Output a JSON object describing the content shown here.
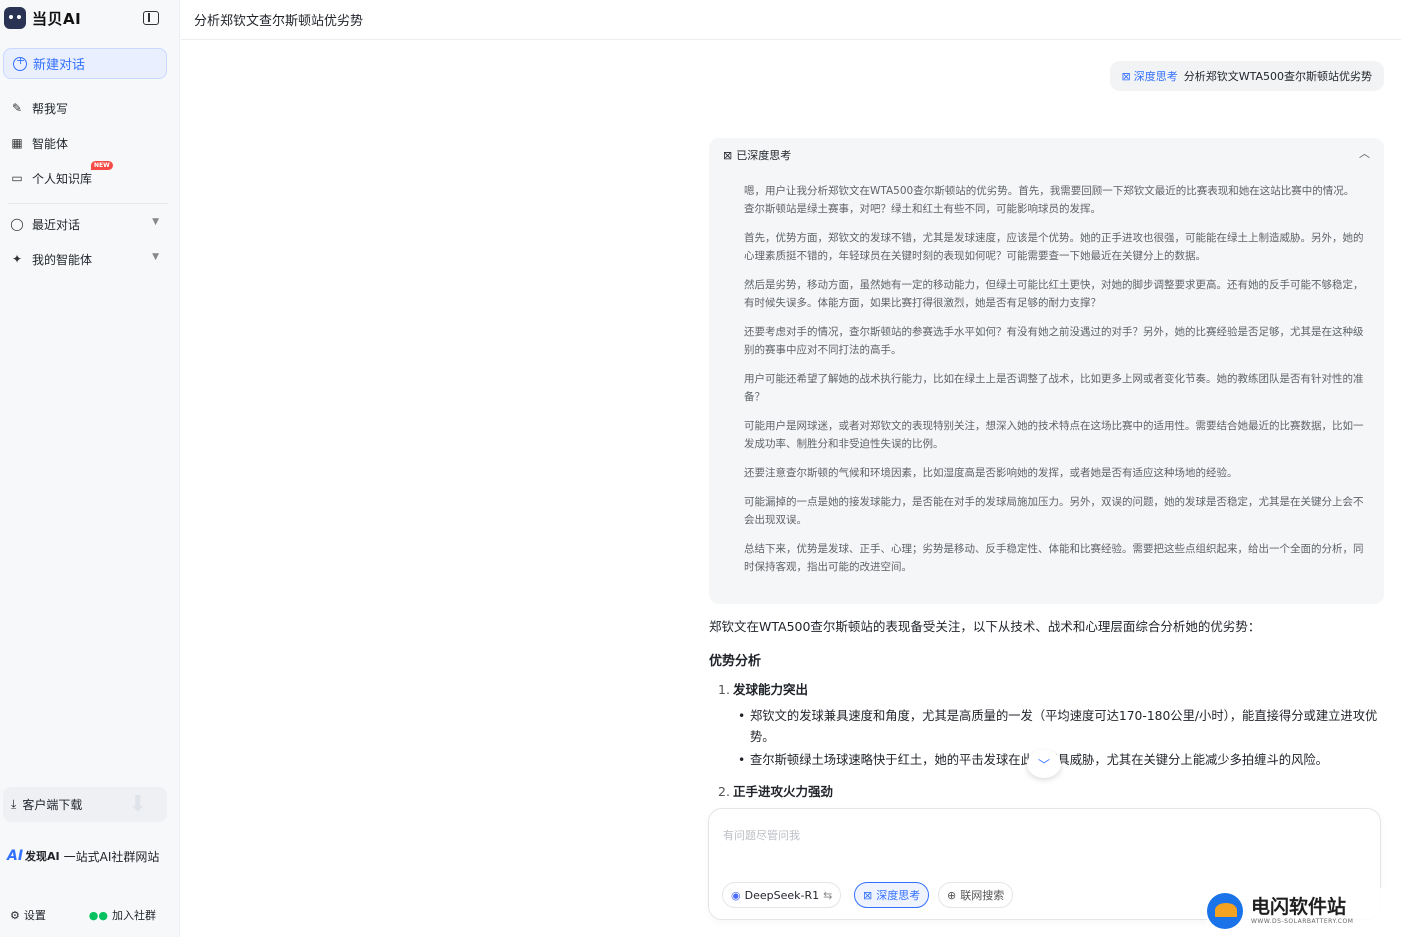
{
  "app": {
    "name": "当贝AI"
  },
  "sidebar": {
    "new_chat": "新建对话",
    "items": [
      {
        "label": "帮我写",
        "icon": "pen-icon"
      },
      {
        "label": "智能体",
        "icon": "grid-icon"
      },
      {
        "label": "个人知识库",
        "icon": "folder-icon",
        "badge": "NEW"
      }
    ],
    "sections": [
      {
        "label": "最近对话",
        "icon": "chat-bubble-icon"
      },
      {
        "label": "我的智能体",
        "icon": "sparkle-icon"
      }
    ],
    "download": "客户端下载",
    "promo": {
      "mark": "AI",
      "brand": "发现AI",
      "text": "一站式AI社群网站"
    },
    "settings": "设置",
    "join": "加入社群"
  },
  "header": {
    "title": "分析郑钦文查尔斯顿站优劣势"
  },
  "user_message": {
    "tag": "深度思考",
    "text": "分析郑钦文WTA500查尔斯顿站优劣势"
  },
  "thinking": {
    "title": "已深度思考",
    "paragraphs": [
      "嗯，用户让我分析郑钦文在WTA500查尔斯顿站的优劣势。首先，我需要回顾一下郑钦文最近的比赛表现和她在这站比赛中的情况。查尔斯顿站是绿土赛事，对吧？绿土和红土有些不同，可能影响球员的发挥。",
      "首先，优势方面，郑钦文的发球不错，尤其是发球速度，应该是个优势。她的正手进攻也很强，可能能在绿土上制造威胁。另外，她的心理素质挺不错的，年轻球员在关键时刻的表现如何呢？可能需要查一下她最近在关键分上的数据。",
      "然后是劣势，移动方面，虽然她有一定的移动能力，但绿土可能比红土更快，对她的脚步调整要求更高。还有她的反手可能不够稳定，有时候失误多。体能方面，如果比赛打得很激烈，她是否有足够的耐力支撑？",
      "还要考虑对手的情况，查尔斯顿站的参赛选手水平如何？有没有她之前没遇过的对手？另外，她的比赛经验是否足够，尤其是在这种级别的赛事中应对不同打法的高手。",
      "用户可能还希望了解她的战术执行能力，比如在绿土上是否调整了战术，比如更多上网或者变化节奏。她的教练团队是否有针对性的准备？",
      "可能用户是网球迷，或者对郑钦文的表现特别关注，想深入她的技术特点在这场比赛中的适用性。需要结合她最近的比赛数据，比如一发成功率、制胜分和非受迫性失误的比例。",
      "还要注意查尔斯顿的气候和环境因素，比如湿度高是否影响她的发挥，或者她是否有适应这种场地的经验。",
      "可能漏掉的一点是她的接发球能力，是否能在对手的发球局施加压力。另外，双误的问题，她的发球是否稳定，尤其是在关键分上会不会出现双误。",
      "总结下来，优势是发球、正手、心理；劣势是移动、反手稳定性、体能和比赛经验。需要把这些点组织起来，给出一个全面的分析，同时保持客观，指出可能的改进空间。"
    ]
  },
  "answer": {
    "intro": "郑钦文在WTA500查尔斯顿站的表现备受关注，以下从技术、战术和心理层面综合分析她的优劣势：",
    "section_title": "优势分析",
    "points": [
      {
        "num": "1.",
        "title": "发球能力突出",
        "bullets": [
          "郑钦文的发球兼具速度和角度，尤其是高质量的一发（平均速度可达170-180公里/小时），能直接得分或建立进攻优势。",
          "查尔斯顿绿土场球速略快于红土，她的平击发球在此时更具威胁，尤其在关键分上能减少多拍缠斗的风险。"
        ]
      },
      {
        "num": "2.",
        "title": "正手进攻火力强劲",
        "bullets": []
      }
    ]
  },
  "composer": {
    "placeholder": "有问题尽管问我",
    "model": "DeepSeek-R1",
    "deep_think": "深度思考",
    "web_search": "联网搜索"
  },
  "watermark": {
    "title": "电闪软件站",
    "url": "WWW.DS-SOLARBATTERY.COM"
  }
}
